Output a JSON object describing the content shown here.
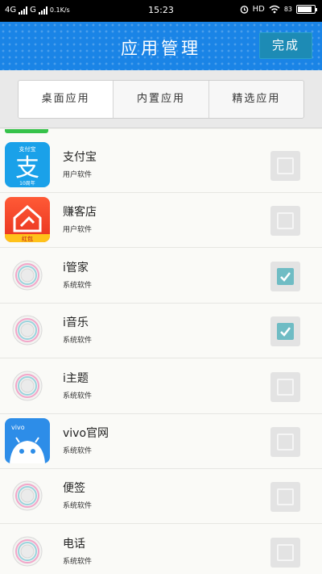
{
  "status_bar": {
    "network": "4G",
    "carrier_network": "G",
    "speed": "0.1K/s",
    "time": "15:23",
    "hd": "HD",
    "battery_percent": 83
  },
  "header": {
    "title": "应用管理",
    "done_label": "完成",
    "color": "#1a84e6"
  },
  "tabs": [
    {
      "label": "桌面应用",
      "active": true
    },
    {
      "label": "内置应用",
      "active": false
    },
    {
      "label": "精选应用",
      "active": false
    }
  ],
  "apps": [
    {
      "name": "支付宝",
      "type": "用户软件",
      "checked": false,
      "icon": "alipay-icon"
    },
    {
      "name": "赚客店",
      "type": "用户软件",
      "checked": false,
      "icon": "shop-icon"
    },
    {
      "name": "i管家",
      "type": "系统软件",
      "checked": true,
      "icon": "placeholder-icon"
    },
    {
      "name": "i音乐",
      "type": "系统软件",
      "checked": true,
      "icon": "placeholder-icon"
    },
    {
      "name": "i主题",
      "type": "系统软件",
      "checked": false,
      "icon": "placeholder-icon"
    },
    {
      "name": "vivo官网",
      "type": "系统软件",
      "checked": false,
      "icon": "vivo-icon"
    },
    {
      "name": "便签",
      "type": "系统软件",
      "checked": false,
      "icon": "placeholder-icon"
    },
    {
      "name": "电话",
      "type": "系统软件",
      "checked": false,
      "icon": "placeholder-icon"
    }
  ],
  "icon_text": {
    "alipay_top": "支付宝",
    "alipay_glyph": "支",
    "alipay_bottom": "10周年",
    "shop_badge": "红包",
    "vivo_brand": "vivo"
  }
}
